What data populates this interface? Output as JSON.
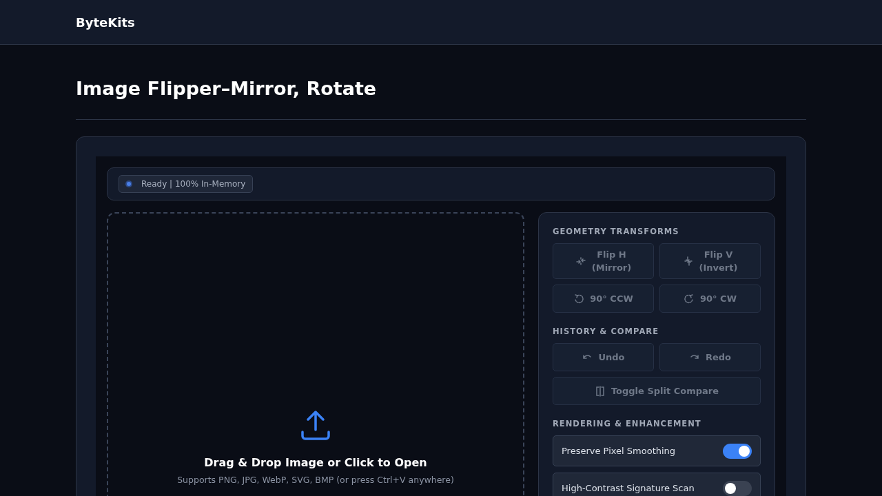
{
  "brand": "ByteKits",
  "page_title": "Image Flipper–Mirror, Rotate",
  "status": {
    "text": "Ready | 100% In-Memory"
  },
  "dropzone": {
    "title": "Drag & Drop Image or Click to Open",
    "hint": "Supports PNG, JPG, WebP, SVG, BMP (or press Ctrl+V anywhere)"
  },
  "sections": [
    {
      "title": "GEOMETRY TRANSFORMS",
      "buttons": [
        {
          "kind": "flip-h",
          "label": "Flip H",
          "sublabel": "(Mirror)",
          "disabled": true
        },
        {
          "kind": "flip-v",
          "label": "Flip V",
          "sublabel": "(Invert)",
          "disabled": true
        },
        {
          "kind": "rotate-ccw",
          "label": "90° CCW",
          "disabled": true
        },
        {
          "kind": "rotate-cw",
          "label": "90° CW",
          "disabled": true
        }
      ]
    },
    {
      "title": "HISTORY & COMPARE",
      "buttons": [
        {
          "kind": "undo",
          "label": "Undo",
          "disabled": true
        },
        {
          "kind": "redo",
          "label": "Redo",
          "disabled": true
        },
        {
          "kind": "split",
          "label": "Toggle Split Compare",
          "disabled": true,
          "wide": true
        }
      ]
    },
    {
      "title": "RENDERING & ENHANCEMENT",
      "toggles": [
        {
          "label": "Preserve Pixel Smoothing",
          "on": true
        },
        {
          "label": "High-Contrast Signature Scan",
          "on": false
        }
      ]
    }
  ]
}
